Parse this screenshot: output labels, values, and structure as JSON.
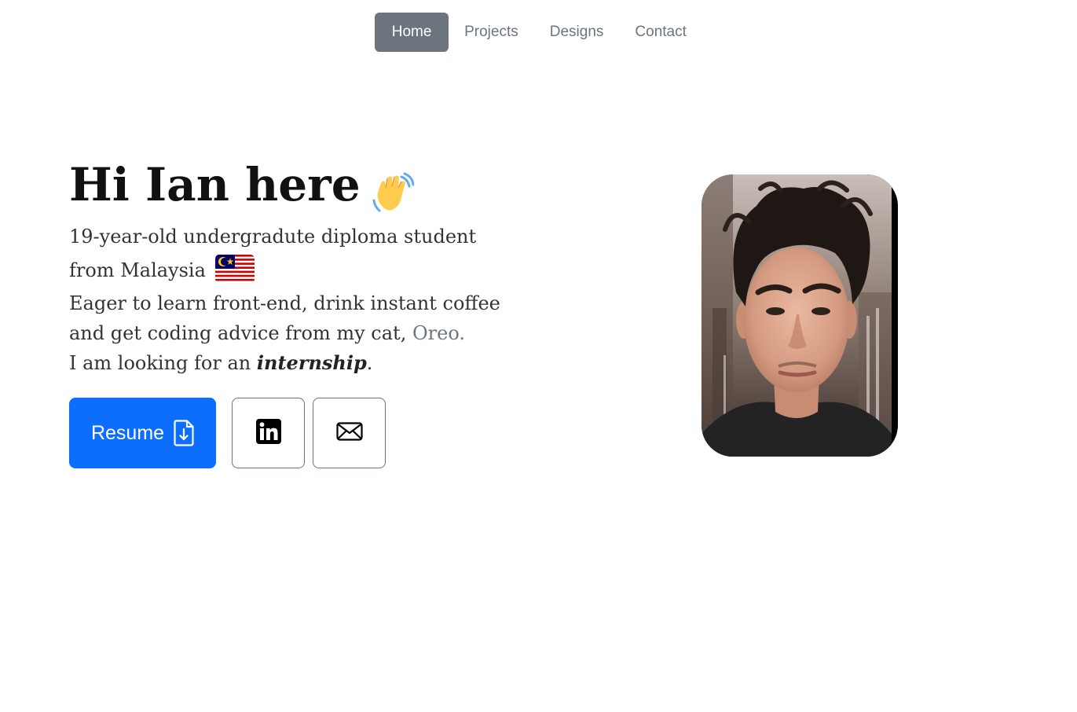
{
  "nav": {
    "items": [
      {
        "label": "Home",
        "active": true
      },
      {
        "label": "Projects",
        "active": false
      },
      {
        "label": "Designs",
        "active": false
      },
      {
        "label": "Contact",
        "active": false
      }
    ]
  },
  "hero": {
    "title": "Hi Ian here",
    "wave_icon": "waving-hand-icon",
    "subtitle_line1": "19-year-old undergradute diploma student",
    "subtitle_line2": "from Malaysia",
    "flag_icon": "malaysia-flag-icon",
    "desc_line1": "Eager to learn front-end, drink instant coffee",
    "desc_line2_prefix": "and get coding advice from my cat,",
    "desc_cat": "Oreo.",
    "desc_line3_prefix": "I am looking for an",
    "desc_internship": "internship",
    "desc_line3_suffix": "."
  },
  "actions": {
    "resume_label": "Resume",
    "resume_icon": "file-download-icon",
    "linkedin_icon": "linkedin-icon",
    "mail_icon": "envelope-icon"
  },
  "colors": {
    "primary": "#0d6efd",
    "nav_active_bg": "#6c757d",
    "muted": "#6c757d"
  }
}
